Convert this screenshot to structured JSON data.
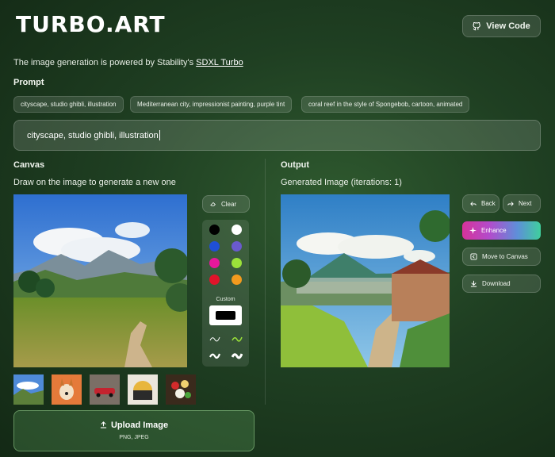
{
  "header": {
    "logo_text": "TURBO",
    "logo_suffix": ".ART",
    "view_code_label": "View Code",
    "view_code_icon": "github-icon"
  },
  "powered": {
    "prefix": "The image generation is powered by Stability's ",
    "link": "SDXL Turbo"
  },
  "prompt": {
    "heading": "Prompt",
    "suggestions": [
      "cityscape, studio ghibli, illustration",
      "Mediterranean city, impressionist painting, purple tint",
      "coral reef in the style of Spongebob, cartoon, animated"
    ],
    "value": "cityscape, studio ghibli, illustration"
  },
  "canvas": {
    "heading": "Canvas",
    "instruction": "Draw on the image to generate a new one",
    "clear_label": "Clear",
    "custom_label": "Custom",
    "colors": [
      "#000000",
      "#ffffff",
      "#1f4fd6",
      "#6a5acd",
      "#e6189b",
      "#9be23a",
      "#e0142a",
      "#f39a1e"
    ],
    "custom_color": "#000000",
    "thumbnails": [
      "mountain-valley-thumb",
      "corgi-thumb",
      "red-car-thumb",
      "moon-sunset-thumb",
      "food-platter-thumb"
    ]
  },
  "output": {
    "heading": "Output",
    "status": "Generated Image (iterations: 1)",
    "back_label": "Back",
    "next_label": "Next",
    "enhance_label": "Enhance",
    "move_label": "Move to Canvas",
    "download_label": "Download"
  },
  "upload": {
    "label": "Upload Image",
    "formats": "PNG, JPEG"
  }
}
